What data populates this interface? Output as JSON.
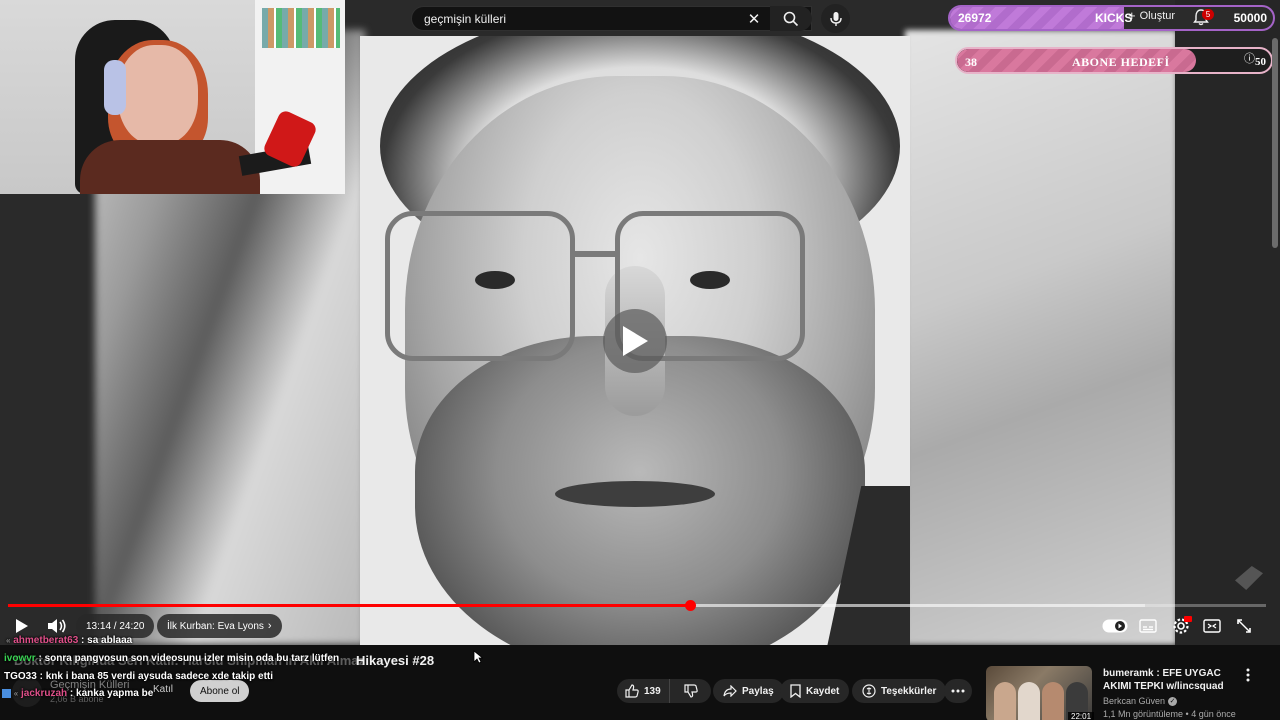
{
  "search": {
    "query": "geçmişin külleri"
  },
  "kicks_bar": {
    "current": "26972",
    "label": "KICKS",
    "goal": "50000",
    "progress": 0.54
  },
  "header": {
    "create_label": "Oluştur",
    "notification_count": "5"
  },
  "subscriber_goal": {
    "current": "38",
    "label": "ABONE HEDEFİ",
    "goal": "50",
    "progress": 0.76
  },
  "player": {
    "time": "13:14 / 24:20",
    "chapter": "İlk Kurban: Eva Lyons",
    "progress": 0.542,
    "buffered": 0.904
  },
  "chat": [
    {
      "user": "ahmetberat63",
      "message": "sa ablaaa",
      "color": "#e0508a"
    },
    {
      "user": "ivowvr",
      "message": "sonra pangvosun son videosunu izler misin oda bu tarz lütfen",
      "color": "#39d353"
    },
    {
      "user": "TGO33",
      "message": "knk i bana 85 verdi aysuda sadece xde takip etti",
      "color": "#ffffff"
    },
    {
      "user": "jackruzah",
      "message": "kanka yapma be",
      "color": "#e0508a"
    }
  ],
  "video": {
    "title_hidden": "Doktor Kılığında Seri Katil: Harold Shipman'ın Akıl Almaz",
    "title_visible": "Hikayesi #28",
    "channel_name": "Geçmişin Külleri",
    "channel_subs": "2,06 B abone",
    "join_label": "Katıl",
    "subscribe_label": "Abone ol",
    "likes": "139",
    "share_label": "Paylaş",
    "save_label": "Kaydet",
    "thanks_label": "Teşekkürler"
  },
  "recommendation": {
    "title": "bumeramk : EFE UYGAC AKIMI TEPKI w/lincsquad",
    "channel": "Berkcan Güven",
    "meta": "1,1 Mn görüntüleme • 4 gün önce",
    "duration": "22:01"
  },
  "colors": {
    "accent": "#ff0000",
    "kicks": "#c07ad9",
    "abone": "#d9789e"
  }
}
